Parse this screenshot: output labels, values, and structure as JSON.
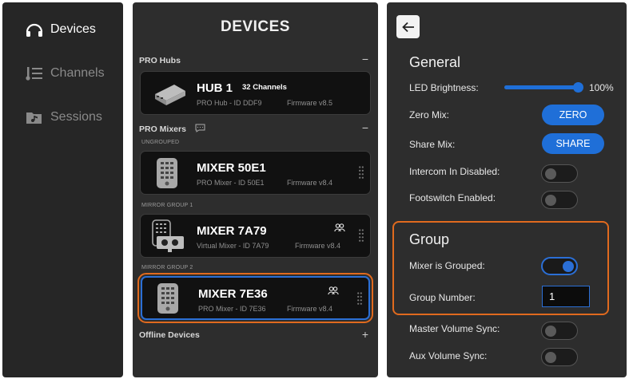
{
  "nav": {
    "items": [
      {
        "label": "Devices",
        "icon": "headphones-icon",
        "active": true
      },
      {
        "label": "Channels",
        "icon": "channels-list-icon",
        "active": false
      },
      {
        "label": "Sessions",
        "icon": "music-folder-icon",
        "active": false
      }
    ]
  },
  "devices": {
    "title": "DEVICES",
    "hubs_label": "PRO Hubs",
    "hubs_toggle": "−",
    "mixers_label": "PRO Mixers",
    "mixers_toggle": "−",
    "ungrouped_label": "UNGROUPED",
    "mirror1_label": "MIRROR GROUP 1",
    "mirror2_label": "MIRROR GROUP 2",
    "offline_label": "Offline Devices",
    "offline_toggle": "+",
    "hub": {
      "name": "HUB 1",
      "extra": "32 Channels",
      "sub": "PRO Hub - ID DDF9",
      "fw": "Firmware v8.5"
    },
    "mixers": [
      {
        "name": "MIXER 50E1",
        "sub": "PRO Mixer - ID 50E1",
        "fw": "Firmware v8.4"
      },
      {
        "name": "MIXER 7A79",
        "sub": "Virtual Mixer - ID 7A79",
        "fw": "Firmware v8.4"
      },
      {
        "name": "MIXER 7E36",
        "sub": "PRO Mixer - ID 7E36",
        "fw": "Firmware v8.4"
      }
    ]
  },
  "settings": {
    "general_title": "General",
    "led_label": "LED Brightness:",
    "led_value": "100%",
    "led_level": 1.0,
    "zero_label": "Zero Mix:",
    "zero_button": "ZERO",
    "share_label": "Share Mix:",
    "share_button": "SHARE",
    "intercom_label": "Intercom In Disabled:",
    "footswitch_label": "Footswitch Enabled:",
    "group_title": "Group",
    "grouped_label": "Mixer is Grouped:",
    "group_number_label": "Group Number:",
    "group_number_value": "1",
    "master_sync_label": "Master Volume Sync:",
    "aux_sync_label": "Aux Volume Sync:"
  },
  "colors": {
    "accent": "#1f6fd8",
    "highlight": "#e06a1e"
  }
}
